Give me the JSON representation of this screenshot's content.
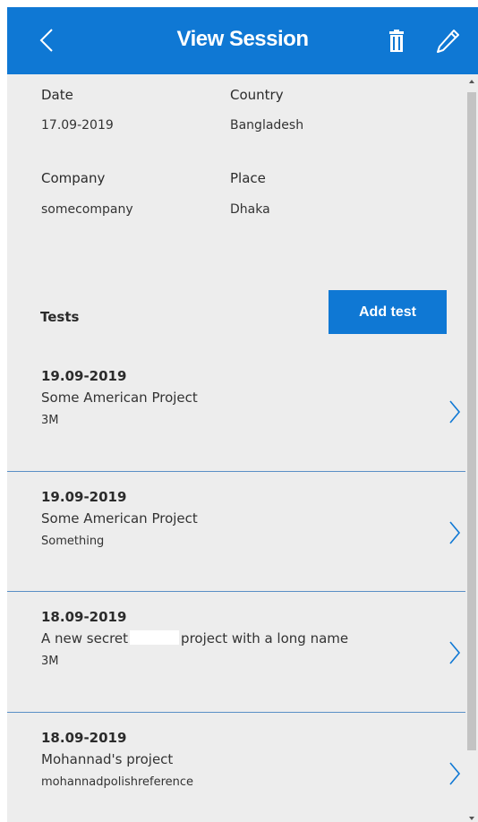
{
  "header": {
    "title": "View Session"
  },
  "details": {
    "date_label": "Date",
    "date_value": "17.09-2019",
    "country_label": "Country",
    "country_value": "Bangladesh",
    "company_label": "Company",
    "company_value": "somecompany",
    "place_label": "Place",
    "place_value": "Dhaka"
  },
  "tests": {
    "heading": "Tests",
    "add_button_label": "Add test",
    "items": [
      {
        "date": "19.09-2019",
        "name": "Some American Project",
        "sub": "3M"
      },
      {
        "date": "19.09-2019",
        "name": "Some American Project",
        "sub": "Something"
      },
      {
        "date": "18.09-2019",
        "name_before": "A new secret",
        "name_after": "project with a long name",
        "sub": "3M"
      },
      {
        "date": "18.09-2019",
        "name": "Mohannad's project",
        "sub": "mohannadpolishreference"
      }
    ]
  },
  "icons": {
    "back": "chevron-left-icon",
    "delete": "trash-icon",
    "edit": "pencil-icon",
    "item_open": "chevron-right-icon"
  },
  "colors": {
    "accent": "#0f78d4",
    "background": "#ededed",
    "divider": "#5a8fc6"
  }
}
